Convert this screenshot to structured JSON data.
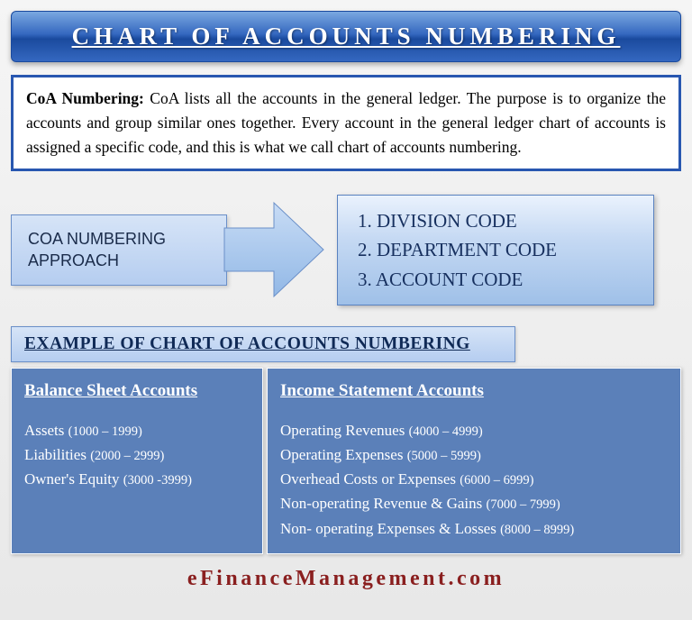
{
  "title": "CHART OF ACCOUNTS NUMBERING",
  "desc": {
    "label": "CoA Numbering:",
    "text": " CoA lists all the accounts in the general ledger. The purpose is to organize the accounts and group similar ones together. Every account in the general ledger chart of accounts is assigned a specific code, and this is what we call chart of accounts numbering."
  },
  "approach": {
    "line1": "COA NUMBERING",
    "line2": "APPROACH"
  },
  "codes": {
    "c1": "1. DIVISION CODE",
    "c2": "2. DEPARTMENT CODE",
    "c3": "3. ACCOUNT CODE"
  },
  "example_header": "EXAMPLE OF CHART OF ACCOUNTS NUMBERING",
  "balance": {
    "heading": "Balance Sheet Accounts",
    "items": [
      {
        "name": "Assets",
        "range": "(1000 – 1999)"
      },
      {
        "name": "Liabilities",
        "range": "(2000 – 2999)"
      },
      {
        "name": "Owner's Equity",
        "range": "(3000 -3999)"
      }
    ]
  },
  "income": {
    "heading": "Income Statement Accounts ",
    "items": [
      {
        "name": "Operating Revenues",
        "range": "(4000 – 4999)"
      },
      {
        "name": "Operating Expenses",
        "range": "(5000 – 5999)"
      },
      {
        "name": "Overhead Costs or Expenses",
        "range": "(6000 – 6999)"
      },
      {
        "name": "Non-operating Revenue & Gains",
        "range": "(7000 – 7999)"
      },
      {
        "name": "Non- operating Expenses & Losses",
        "range": "(8000 – 8999)"
      }
    ]
  },
  "footer": "eFinanceManagement.com"
}
